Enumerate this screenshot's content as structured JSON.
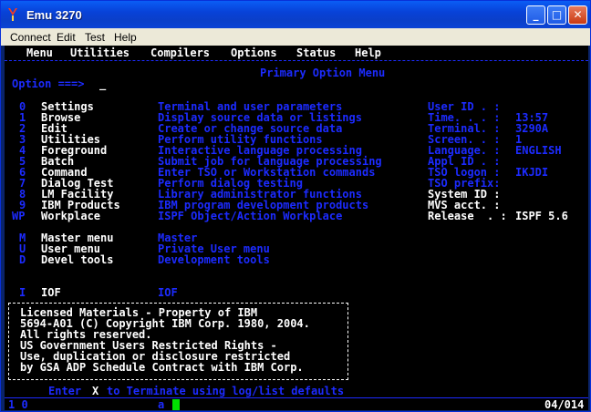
{
  "window": {
    "title": "Emu 3270"
  },
  "menubar": [
    "Connect",
    "Edit",
    "Test",
    "Help"
  ],
  "ispf_menu": [
    "Menu",
    "Utilities",
    "Compilers",
    "Options",
    "Status",
    "Help"
  ],
  "panel_title": "Primary Option Menu",
  "command": {
    "label": "Option ===>",
    "value": "_"
  },
  "options": [
    {
      "code": "0",
      "name": "Settings",
      "desc": "Terminal and user parameters"
    },
    {
      "code": "1",
      "name": "Browse",
      "desc": "Display source data or listings"
    },
    {
      "code": "2",
      "name": "Edit",
      "desc": "Create or change source data"
    },
    {
      "code": "3",
      "name": "Utilities",
      "desc": "Perform utility functions"
    },
    {
      "code": "4",
      "name": "Foreground",
      "desc": "Interactive language processing"
    },
    {
      "code": "5",
      "name": "Batch",
      "desc": "Submit job for language processing"
    },
    {
      "code": "6",
      "name": "Command",
      "desc": "Enter TSO or Workstation commands"
    },
    {
      "code": "7",
      "name": "Dialog Test",
      "desc": "Perform dialog testing"
    },
    {
      "code": "8",
      "name": "LM Facility",
      "desc": "Library administrator functions"
    },
    {
      "code": "9",
      "name": "IBM Products",
      "desc": "IBM program development products"
    },
    {
      "code": "WP",
      "name": "Workplace",
      "desc": "ISPF Object/Action Workplace"
    }
  ],
  "options2": [
    {
      "code": "M",
      "name": "Master menu",
      "desc": "Master"
    },
    {
      "code": "U",
      "name": "User menu",
      "desc": "Private User menu"
    },
    {
      "code": "D",
      "name": "Devel tools",
      "desc": "Development tools"
    }
  ],
  "options3": [
    {
      "code": "I",
      "name": "IOF",
      "desc": "IOF"
    }
  ],
  "info": [
    {
      "label": "User ID . :",
      "value": ""
    },
    {
      "label": "Time. . . :",
      "value": "13:57"
    },
    {
      "label": "Terminal. :",
      "value": "3290A"
    },
    {
      "label": "Screen. . :",
      "value": "1"
    },
    {
      "label": "Language. :",
      "value": "ENGLISH"
    },
    {
      "label": "Appl ID . :",
      "value": ""
    },
    {
      "label": "TSO logon :",
      "value": "IKJDI"
    },
    {
      "label": "TSO prefix:",
      "value": ""
    },
    {
      "label": "System ID :",
      "value": ""
    },
    {
      "label": "MVS acct. :",
      "value": ""
    },
    {
      "label": "Release  . :",
      "value": "ISPF 5.6"
    }
  ],
  "notice": [
    "Licensed Materials - Property of IBM",
    "5694-A01 (C) Copyright IBM Corp. 1980, 2004.",
    "All rights reserved.",
    "US Government Users Restricted Rights -",
    "Use, duplication or disclosure restricted",
    "by GSA ADP Schedule Contract with IBM Corp."
  ],
  "footer": {
    "enter": "Enter",
    "x": "X",
    "rest": "to Terminate using log/list defaults"
  },
  "status": {
    "left": "1 0",
    "indicator": "a",
    "position": "04/014"
  },
  "colors": {
    "white": "#ffffff",
    "blue": "#1c2bff",
    "cyan": "#2ad4ff",
    "green": "#00e000",
    "titlebar": "#0842d8"
  }
}
